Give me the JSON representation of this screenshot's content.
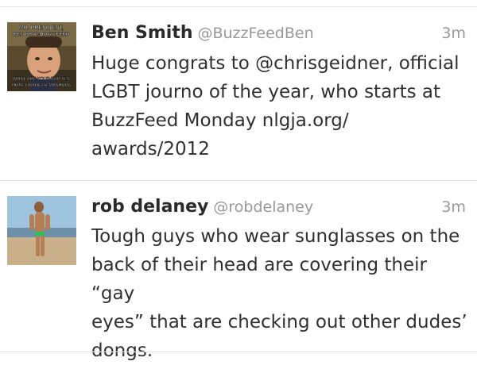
{
  "timeline": {
    "tweets": [
      {
        "display_name": "Ben Smith",
        "handle": "@BuzzFeedBen",
        "time": "3m",
        "lines": [
          "Huge congrats to @chrisgeidner, official",
          "LGBT journo of the year, who starts at",
          "BuzzFeed Monday nlgja.org/",
          "awards/2012"
        ],
        "avatar": {
          "text_top_1": "MR. PRESIDENT,",
          "text_top_2": "BEN FROM BUZZFEED",
          "text_bottom_1": "WHAT ARE YOUR TOP TEN",
          "text_bottom_2": "HONEY BADGER MASHUPS"
        }
      },
      {
        "display_name": "rob delaney",
        "handle": "@robdelaney",
        "time": "3m",
        "lines": [
          "Tough guys who wear sunglasses on the",
          "back of their head are covering their “gay",
          "eyes” that are checking out other dudes’",
          "dongs."
        ]
      }
    ]
  },
  "colors": {
    "name": "#2a2a2a",
    "meta": "#999999",
    "body": "#303030",
    "divider": "#e4e4e4"
  }
}
